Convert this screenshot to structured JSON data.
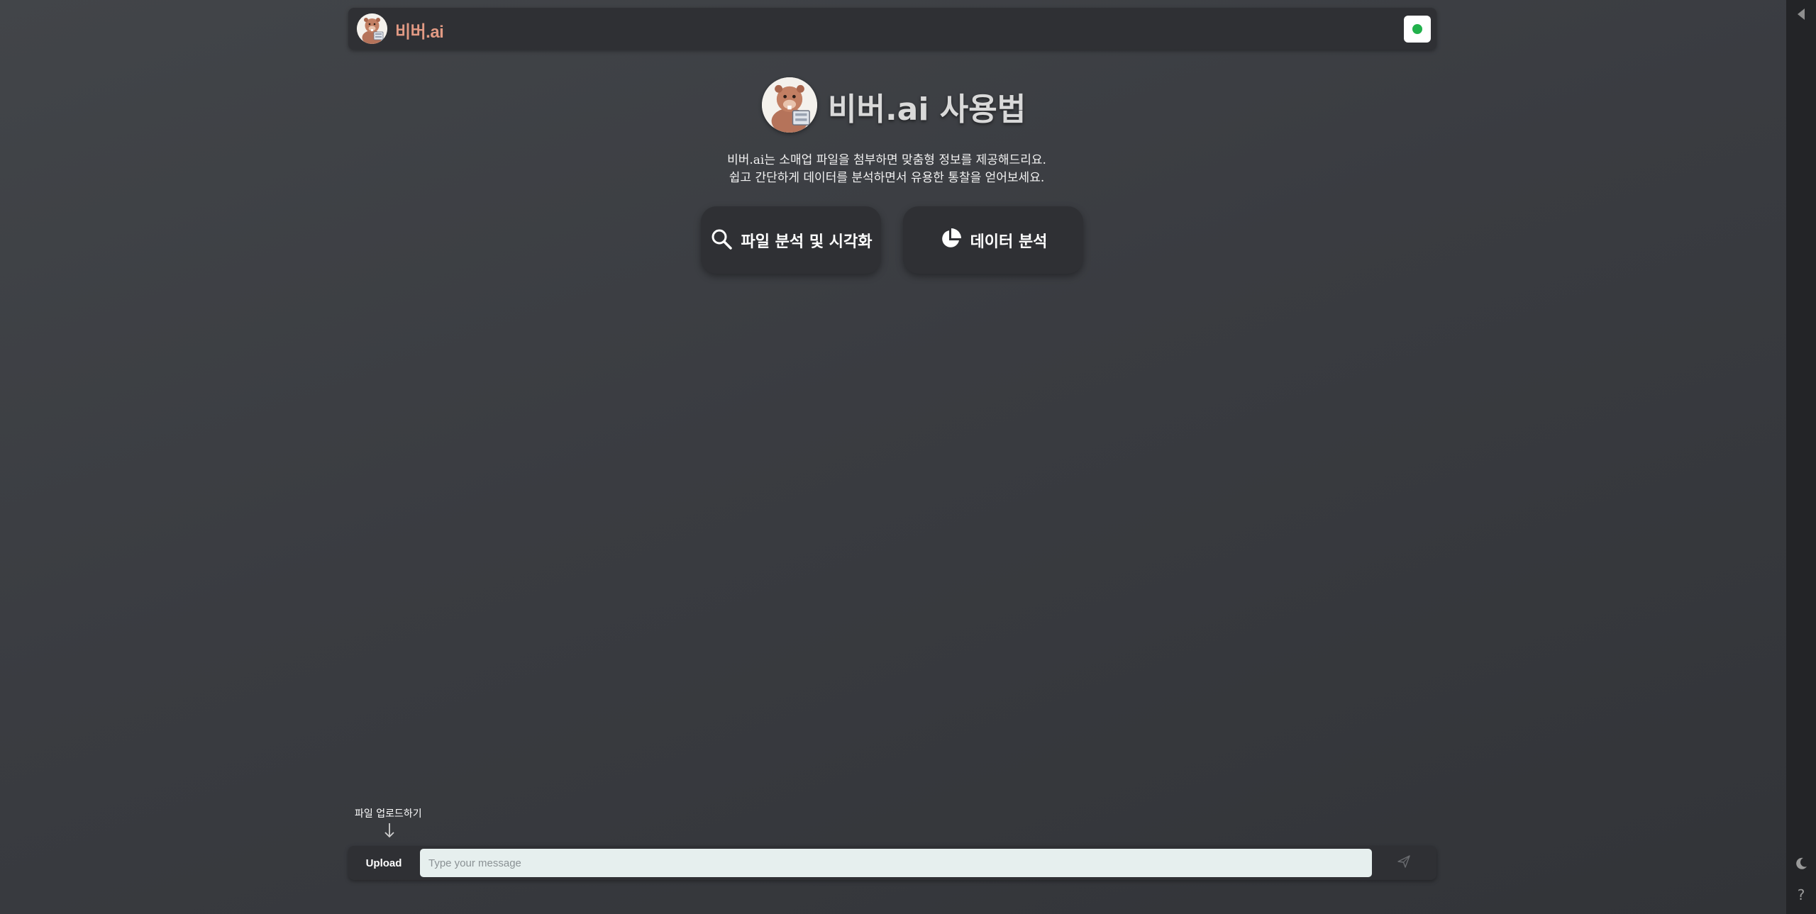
{
  "header": {
    "brand": "비버.ai",
    "status_color": "#22b14c"
  },
  "hero": {
    "title": "비버.ai 사용법",
    "desc_line1": "비버.ai는 소매업 파일을 첨부하면 맞춤형 정보를 제공해드리요.",
    "desc_line2": "쉽고 간단하게 데이터를 분석하면서 유용한 통찰을 얻어보세요."
  },
  "features": [
    {
      "label": "파일 분석 및 시각화",
      "icon": "search-icon"
    },
    {
      "label": "데이터 분석",
      "icon": "pie-chart-icon"
    }
  ],
  "upload_hint": "파일 업로드하기",
  "input_bar": {
    "upload_label": "Upload",
    "placeholder": "Type your message",
    "value": ""
  },
  "right_rail": {
    "help": "?"
  },
  "colors": {
    "brand": "#e29a84",
    "panel": "#2f3034",
    "input_bg": "#e6efee"
  }
}
